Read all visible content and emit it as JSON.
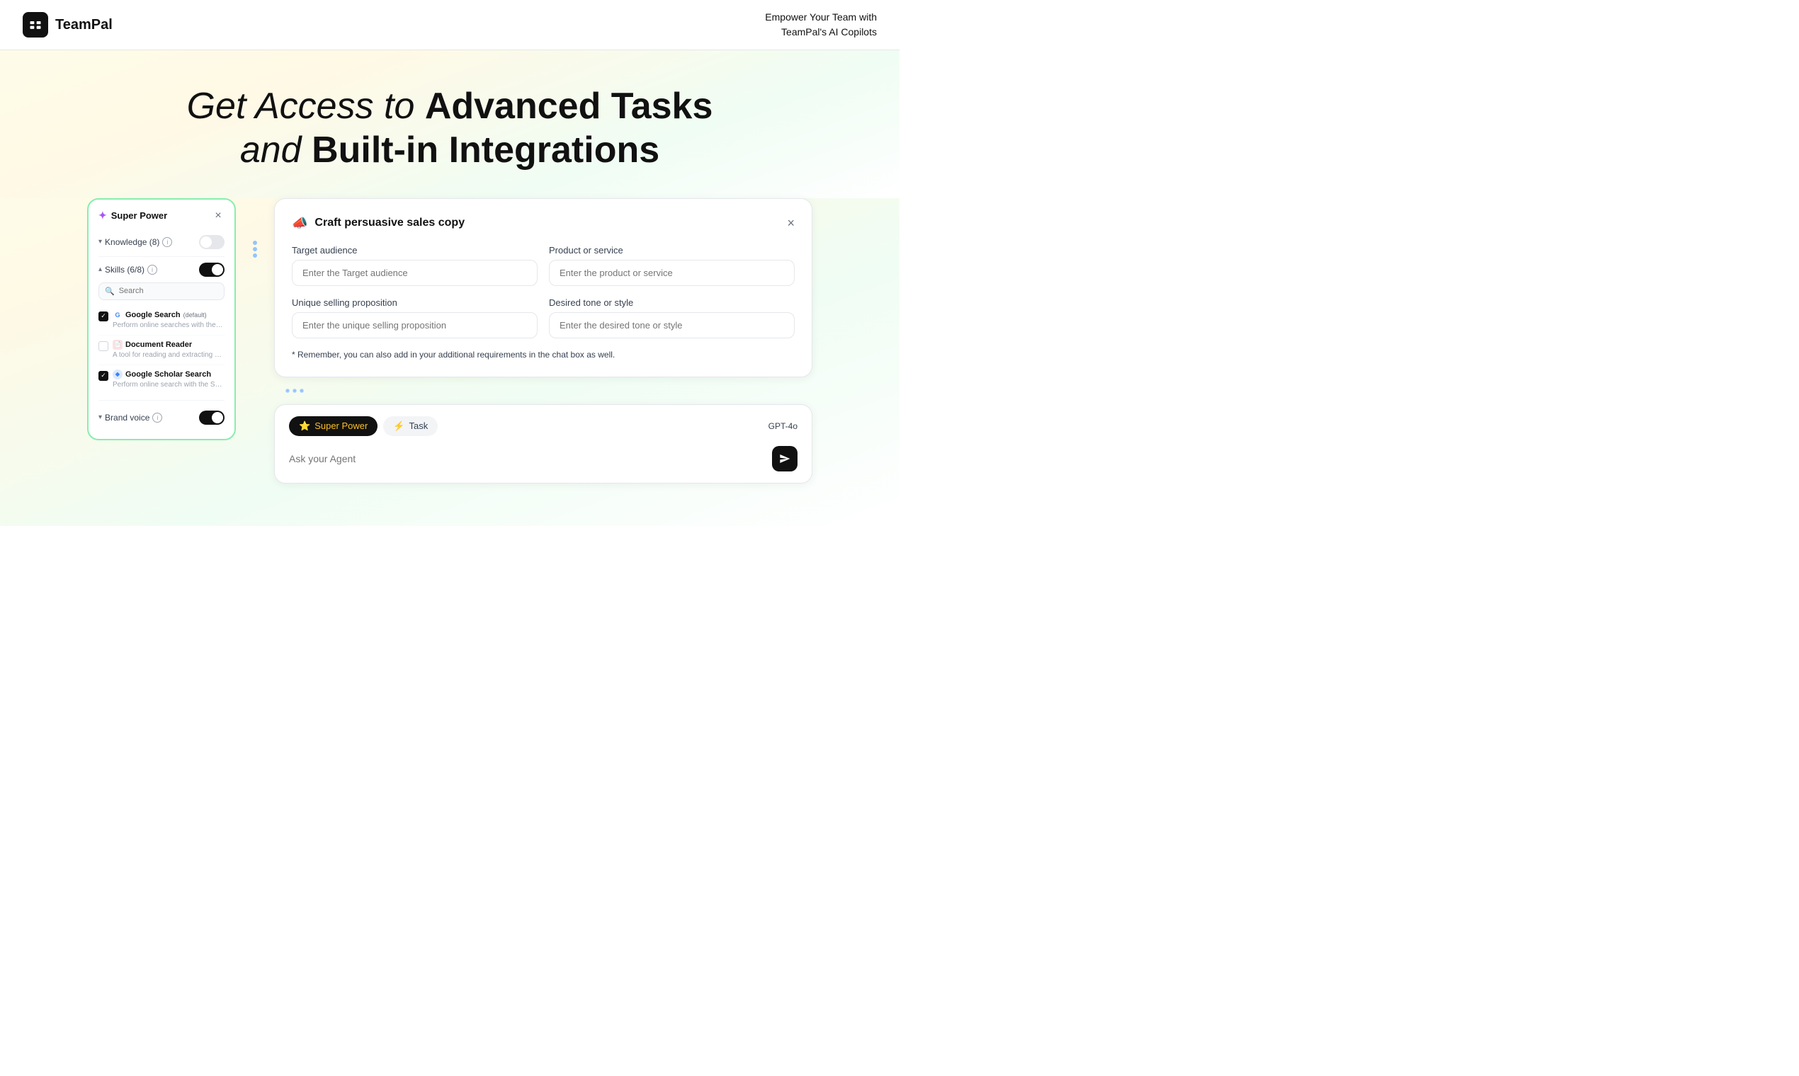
{
  "header": {
    "logo_text": "TeamPal",
    "tagline_line1": "Empower Your Team with",
    "tagline_line2": "TeamPal's AI Copilots"
  },
  "hero": {
    "line1_italic": "Get Access to",
    "line1_bold": "Advanced Tasks",
    "line2_italic": "and",
    "line2_bold": "Built-in Integrations"
  },
  "super_power_panel": {
    "title": "Super Power",
    "close_label": "×",
    "knowledge": {
      "label": "Knowledge (8)",
      "toggle_state": "off"
    },
    "skills": {
      "label": "Skills (6/8)",
      "toggle_state": "on",
      "search_placeholder": "Search",
      "items": [
        {
          "name": "Google Search",
          "badge": "(default)",
          "description": "Perform online searches with the Google search engine. Input a query to receive a list...",
          "checked": true,
          "icon": "google"
        },
        {
          "name": "Document Reader",
          "badge": "",
          "description": "A tool for reading and extracting content from URL of documents, supporting popula...",
          "checked": false,
          "icon": "document"
        },
        {
          "name": "Google Scholar Search",
          "badge": "",
          "description": "Perform online search with the Schola...",
          "checked": true,
          "icon": "scholar"
        }
      ]
    },
    "brand_voice": {
      "label": "Brand voice",
      "toggle_state": "on"
    }
  },
  "craft_panel": {
    "emoji": "📣",
    "title": "Craft persuasive sales copy",
    "close_label": "×",
    "fields": [
      {
        "label": "Target audience",
        "placeholder": "Enter the Target audience",
        "id": "target-audience"
      },
      {
        "label": "Product or service",
        "placeholder": "Enter the product or service",
        "id": "product-service"
      },
      {
        "label": "Unique selling proposition",
        "placeholder": "Enter the unique selling proposition",
        "id": "selling-prop"
      },
      {
        "label": "Desired tone or style",
        "placeholder": "Enter the desired tone or style",
        "id": "tone-style"
      }
    ],
    "note": "* Remember, you can also add in your additional requirements in the chat box as well."
  },
  "chat_panel": {
    "tabs": [
      {
        "label": "Super Power",
        "icon": "⭐",
        "active": true
      },
      {
        "label": "Task",
        "icon": "⚡",
        "active": false
      }
    ],
    "gpt_badge": "GPT-4o",
    "input_placeholder": "Ask your Agent",
    "send_icon": "send"
  }
}
